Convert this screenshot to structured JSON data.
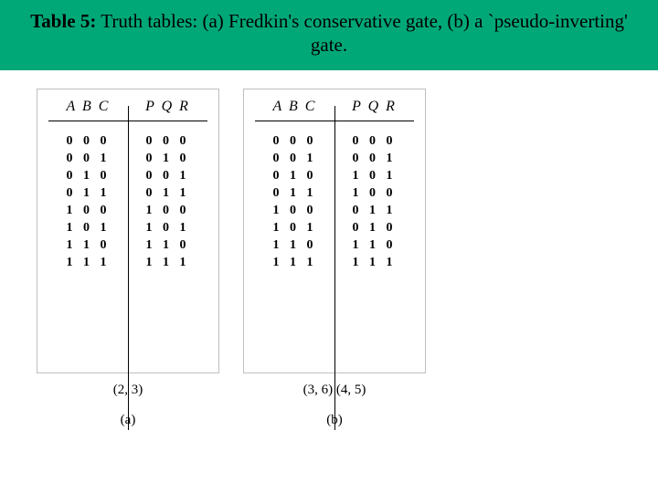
{
  "caption": {
    "label": "Table 5:",
    "text": " Truth tables: (a) Fredkin's conservative gate, (b) a `pseudo-inverting' gate."
  },
  "panels": [
    {
      "header_in": "A B C",
      "header_out": "P Q R",
      "inputs": [
        "0 0 0",
        "0 0 1",
        "0 1 0",
        "0 1 1",
        "1 0 0",
        "1 0 1",
        "1 1 0",
        "1 1 1"
      ],
      "outputs": [
        "0 0 0",
        "0 1 0",
        "0 0 1",
        "0 1 1",
        "1 0 0",
        "1 0 1",
        "1 1 0",
        "1 1 1"
      ],
      "cycle": "(2, 3)",
      "label": "(a)"
    },
    {
      "header_in": "A B C",
      "header_out": "P Q R",
      "inputs": [
        "0 0 0",
        "0 0 1",
        "0 1 0",
        "0 1 1",
        "1 0 0",
        "1 0 1",
        "1 1 0",
        "1 1 1"
      ],
      "outputs": [
        "0 0 0",
        "0 0 1",
        "1 0 1",
        "1 0 0",
        "0 1 1",
        "0 1 0",
        "1 1 0",
        "1 1 1"
      ],
      "cycle": "(3, 6) (4, 5)",
      "label": "(b)"
    }
  ],
  "chart_data": {
    "type": "table",
    "title": "Table 5: Truth tables: (a) Fredkin's conservative gate, (b) a `pseudo-inverting' gate.",
    "tables": [
      {
        "name": "Fredkin conservative gate",
        "columns_in": [
          "A",
          "B",
          "C"
        ],
        "columns_out": [
          "P",
          "Q",
          "R"
        ],
        "rows": [
          {
            "in": [
              0,
              0,
              0
            ],
            "out": [
              0,
              0,
              0
            ]
          },
          {
            "in": [
              0,
              0,
              1
            ],
            "out": [
              0,
              1,
              0
            ]
          },
          {
            "in": [
              0,
              1,
              0
            ],
            "out": [
              0,
              0,
              1
            ]
          },
          {
            "in": [
              0,
              1,
              1
            ],
            "out": [
              0,
              1,
              1
            ]
          },
          {
            "in": [
              1,
              0,
              0
            ],
            "out": [
              1,
              0,
              0
            ]
          },
          {
            "in": [
              1,
              0,
              1
            ],
            "out": [
              1,
              0,
              1
            ]
          },
          {
            "in": [
              1,
              1,
              0
            ],
            "out": [
              1,
              1,
              0
            ]
          },
          {
            "in": [
              1,
              1,
              1
            ],
            "out": [
              1,
              1,
              1
            ]
          }
        ],
        "cycle_notation": "(2, 3)"
      },
      {
        "name": "pseudo-inverting gate",
        "columns_in": [
          "A",
          "B",
          "C"
        ],
        "columns_out": [
          "P",
          "Q",
          "R"
        ],
        "rows": [
          {
            "in": [
              0,
              0,
              0
            ],
            "out": [
              0,
              0,
              0
            ]
          },
          {
            "in": [
              0,
              0,
              1
            ],
            "out": [
              0,
              0,
              1
            ]
          },
          {
            "in": [
              0,
              1,
              0
            ],
            "out": [
              1,
              0,
              1
            ]
          },
          {
            "in": [
              0,
              1,
              1
            ],
            "out": [
              1,
              0,
              0
            ]
          },
          {
            "in": [
              1,
              0,
              0
            ],
            "out": [
              0,
              1,
              1
            ]
          },
          {
            "in": [
              1,
              0,
              1
            ],
            "out": [
              0,
              1,
              0
            ]
          },
          {
            "in": [
              1,
              1,
              0
            ],
            "out": [
              1,
              1,
              0
            ]
          },
          {
            "in": [
              1,
              1,
              1
            ],
            "out": [
              1,
              1,
              1
            ]
          }
        ],
        "cycle_notation": "(3, 6)(4, 5)"
      }
    ]
  }
}
